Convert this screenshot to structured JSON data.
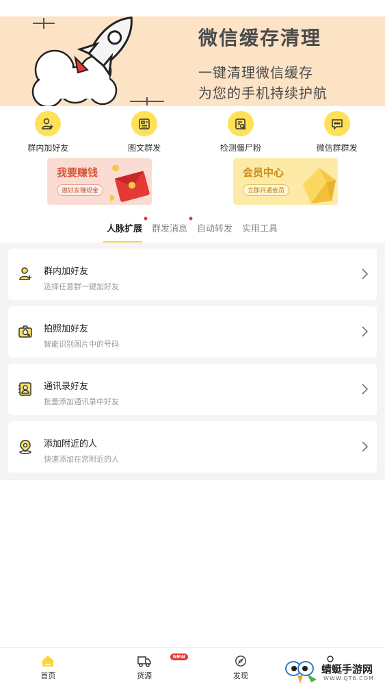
{
  "banner": {
    "title": "微信缓存清理",
    "line1": "一键清理微信缓存",
    "line2": "为您的手机持续护航"
  },
  "quick_actions": [
    {
      "label": "群内加好友",
      "icon": "add-user-icon"
    },
    {
      "label": "图文群发",
      "icon": "document-icon"
    },
    {
      "label": "检测僵尸粉",
      "icon": "search-doc-icon"
    },
    {
      "label": "微信群群发",
      "icon": "chat-icon"
    }
  ],
  "promos": {
    "left": {
      "title": "我要赚钱",
      "button": "邀好友赚现金",
      "icon": "red-envelope-icon"
    },
    "right": {
      "title": "会员中心",
      "button": "立即开通会员",
      "icon": "diamond-icon"
    }
  },
  "tabs": [
    {
      "label": "人脉扩展",
      "active": true,
      "has_dot": true
    },
    {
      "label": "群发消息",
      "active": false,
      "has_dot": true
    },
    {
      "label": "自动转发",
      "active": false,
      "has_dot": false
    },
    {
      "label": "实用工具",
      "active": false,
      "has_dot": false
    }
  ],
  "list": [
    {
      "title": "群内加好友",
      "subtitle": "选择任意群一键加好友",
      "icon": "user-plus-icon"
    },
    {
      "title": "拍照加好友",
      "subtitle": "智能识别图片中的号码",
      "icon": "camera-icon"
    },
    {
      "title": "通讯录好友",
      "subtitle": "批量添加通讯录中好友",
      "icon": "contacts-icon"
    },
    {
      "title": "添加附近的人",
      "subtitle": "快速添加在您附近的人",
      "icon": "location-icon"
    }
  ],
  "bottom_nav": [
    {
      "label": "首页",
      "icon": "home-icon",
      "active": true
    },
    {
      "label": "货源",
      "icon": "truck-icon",
      "badge": "NEW"
    },
    {
      "label": "发现",
      "icon": "compass-icon"
    },
    {
      "label": "",
      "icon": "profile-icon"
    }
  ],
  "watermark": {
    "text": "蜻蜓手游网",
    "url": "WWW.QT6.COM"
  },
  "colors": {
    "accent": "#ffe158",
    "banner_bg": "#fde3c6",
    "list_bg": "#f4f4f4"
  }
}
